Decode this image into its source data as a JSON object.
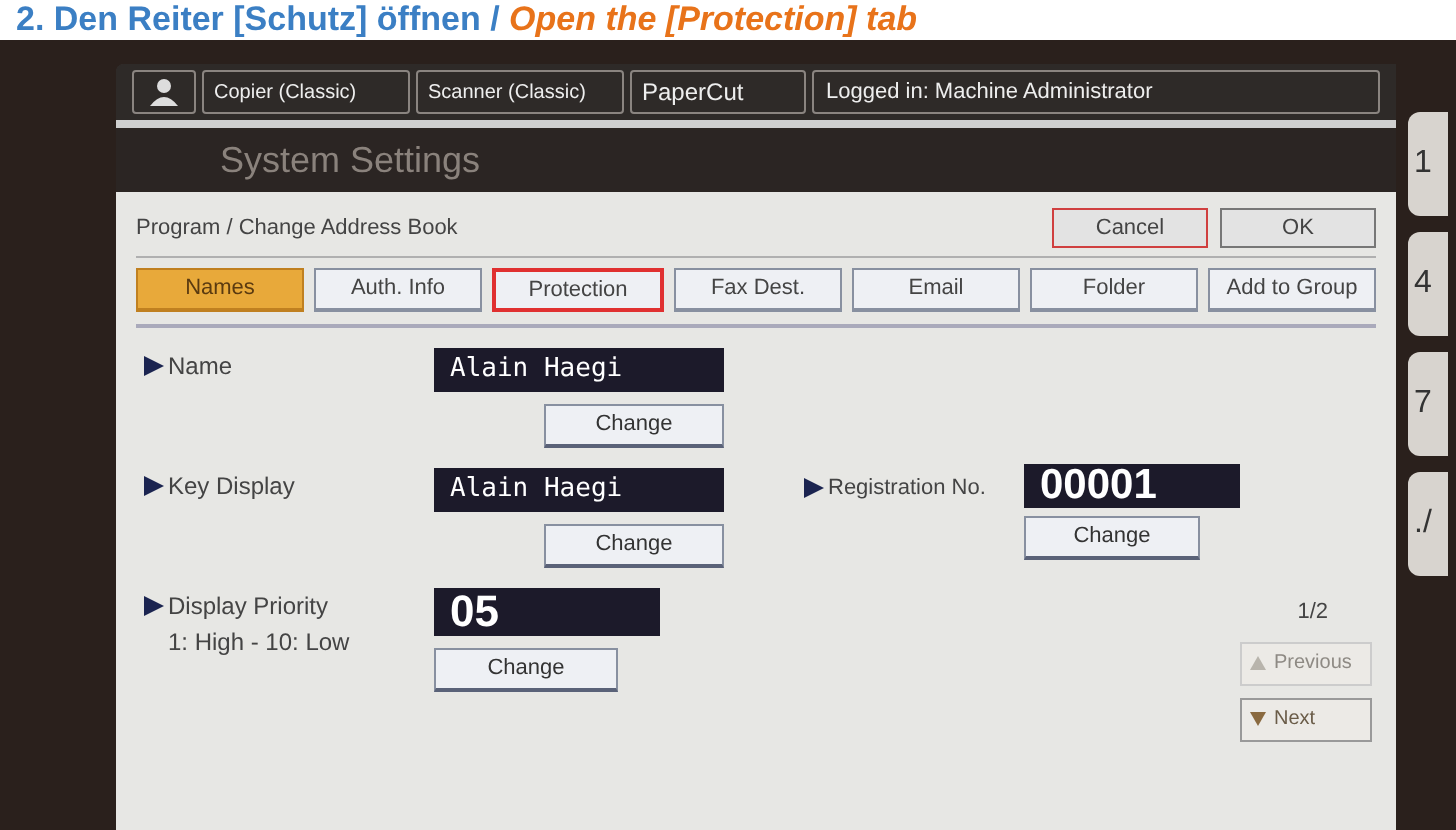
{
  "caption": {
    "german": "2. Den Reiter [Schutz] öffnen / ",
    "english": "Open the [Protection] tab"
  },
  "top_bar": {
    "items": [
      {
        "kind": "user"
      },
      {
        "kind": "mode",
        "label": "Copier (Classic)"
      },
      {
        "kind": "mode",
        "label": "Scanner (Classic)"
      },
      {
        "kind": "mode",
        "label": "PaperCut"
      },
      {
        "kind": "status",
        "label": "Logged in: Machine Administrator"
      }
    ]
  },
  "window": {
    "title": "System Settings"
  },
  "dialog": {
    "title": "Program / Change Address Book",
    "buttons": [
      {
        "label": "Cancel",
        "kind": "cancel"
      },
      {
        "label": "OK",
        "kind": "ok"
      }
    ]
  },
  "tabs": [
    {
      "label": "Names",
      "selected": true,
      "highlighted": false
    },
    {
      "label": "Auth. Info",
      "selected": false,
      "highlighted": false
    },
    {
      "label": "Protection",
      "selected": false,
      "highlighted": true
    },
    {
      "label": "Fax Dest.",
      "selected": false,
      "highlighted": false
    },
    {
      "label": "Email",
      "selected": false,
      "highlighted": false
    },
    {
      "label": "Folder",
      "selected": false,
      "highlighted": false
    },
    {
      "label": "Add to Group",
      "selected": false,
      "highlighted": false
    }
  ],
  "fields": [
    {
      "label": "Name",
      "value": "Alain Haegi",
      "button": "Change",
      "kind": "text"
    },
    {
      "label": "Key Display",
      "value": "Alain Haegi",
      "button": "Change",
      "kind": "text"
    },
    {
      "label": "Display Priority",
      "hint": "1: High - 10: Low",
      "value": "05",
      "button": "Change",
      "kind": "number"
    }
  ],
  "registration": {
    "label": "Registration No.",
    "value": "00001",
    "button": "Change"
  },
  "pager": {
    "page": "1/2",
    "previous": {
      "label": "Previous",
      "disabled": true
    },
    "next": {
      "label": "Next",
      "disabled": false
    }
  },
  "keypad": [
    "1",
    "4",
    "7",
    "./"
  ]
}
